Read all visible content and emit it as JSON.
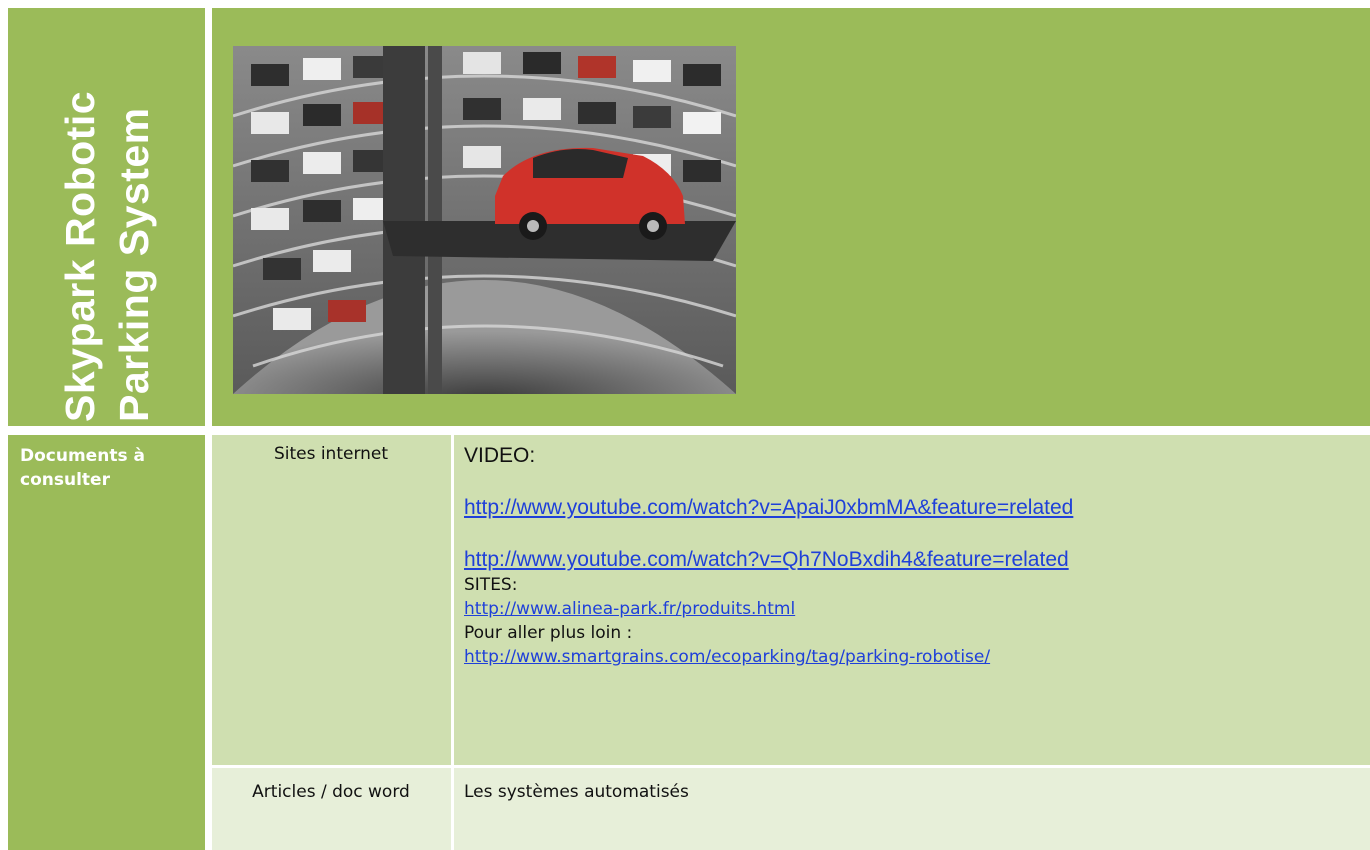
{
  "header": {
    "title_line1": "Skypark Robotic",
    "title_line2": "Parking System",
    "photo_icon": "robotic-parking-photo"
  },
  "table": {
    "row_header": "Documents à consulter",
    "rows": [
      {
        "label": "Sites internet",
        "video_label": "VIDEO:",
        "video_links": [
          "http://www.youtube.com/watch?v=ApaiJ0xbmMA&feature=related",
          "http://www.youtube.com/watch?v=Qh7NoBxdih4&feature=related"
        ],
        "sites_label": "SITES:",
        "site_link": "http://www.alinea-park.fr/produits.html",
        "further_label": "Pour aller plus loin :",
        "further_link": "http://www.smartgrains.com/ecoparking/tag/parking-robotise/"
      },
      {
        "label": "Articles / doc word",
        "content": "Les systèmes automatisés"
      }
    ]
  },
  "colors": {
    "header_green": "#9bbb59",
    "row_light": "#cfdfb0",
    "row_lighter": "#e7efd9",
    "link": "#1f40d9"
  }
}
